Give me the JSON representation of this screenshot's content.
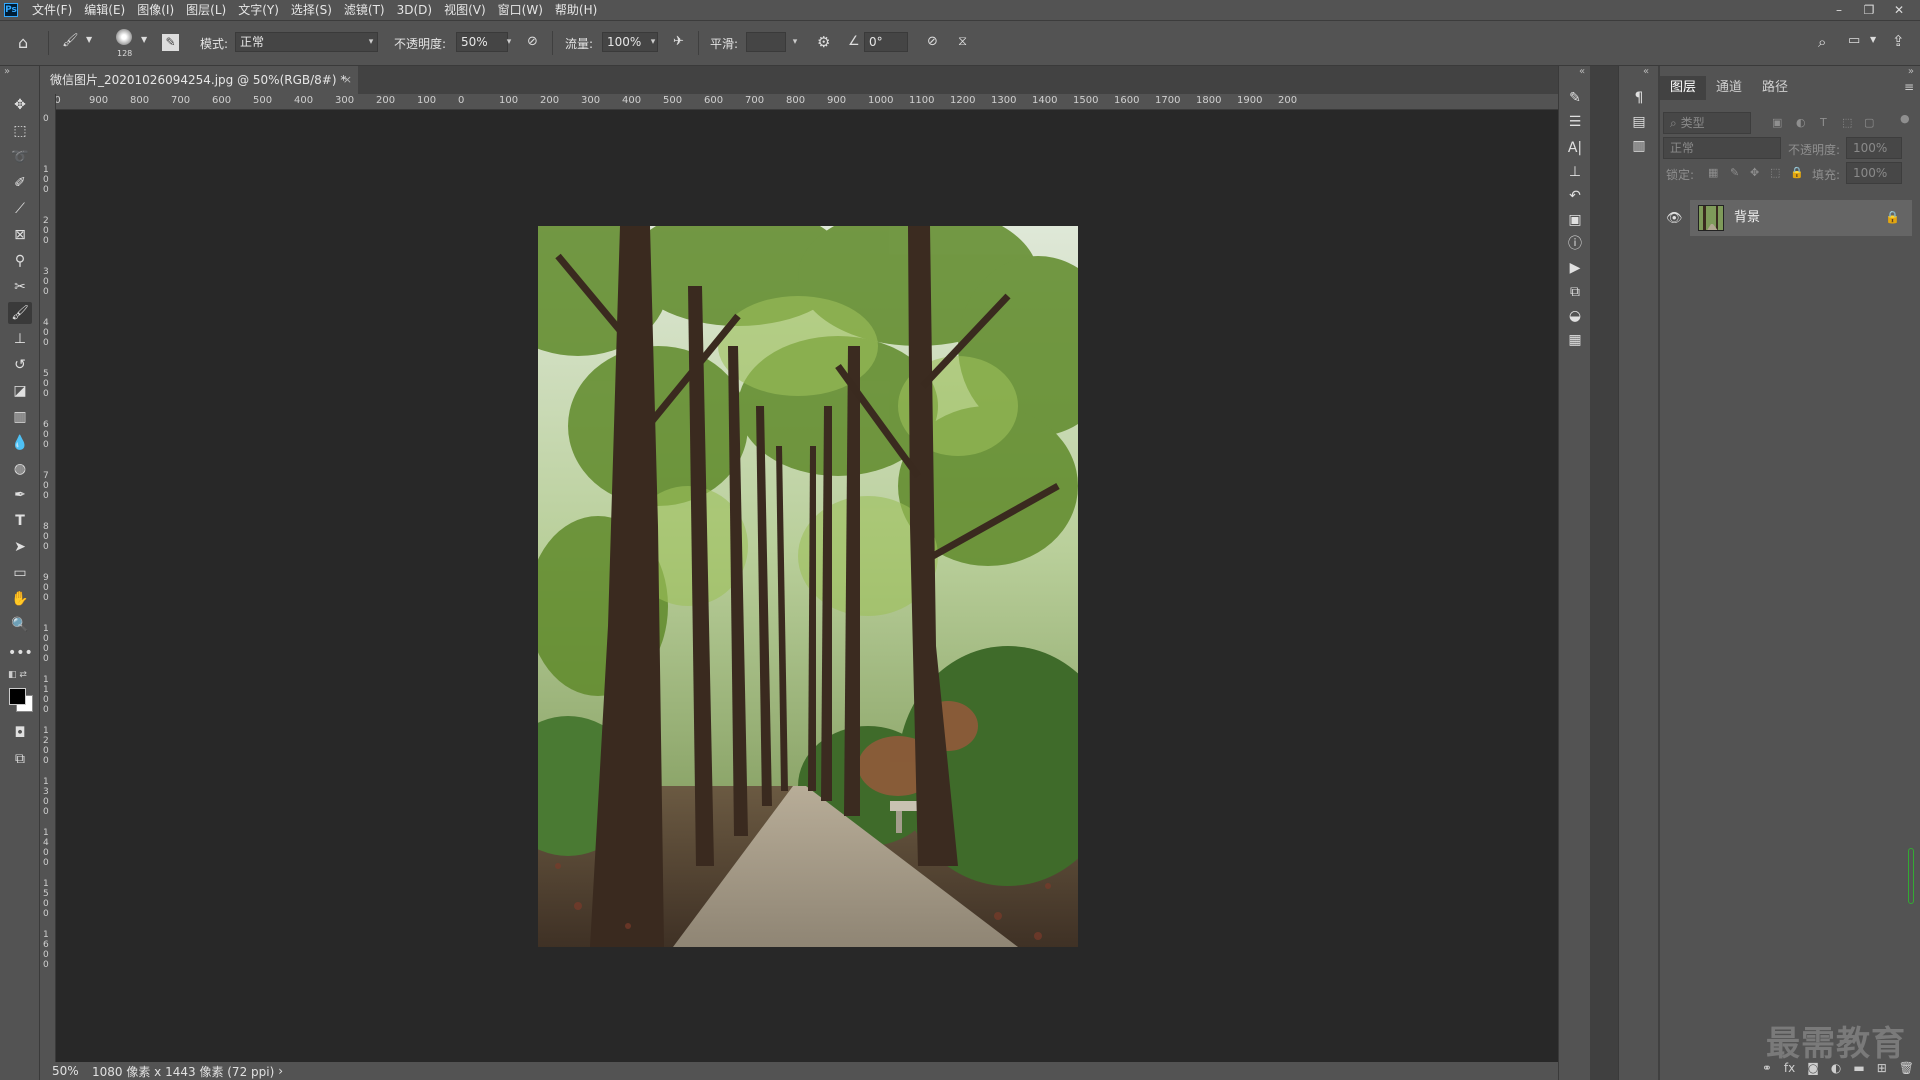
{
  "app": {
    "logo_text": "Ps"
  },
  "menu": [
    "文件(F)",
    "编辑(E)",
    "图像(I)",
    "图层(L)",
    "文字(Y)",
    "选择(S)",
    "滤镜(T)",
    "3D(D)",
    "视图(V)",
    "窗口(W)",
    "帮助(H)"
  ],
  "options": {
    "brush_size": "128",
    "mode_label": "模式:",
    "mode_value": "正常",
    "opacity_label": "不透明度:",
    "opacity_value": "50%",
    "flow_label": "流量:",
    "flow_value": "100%",
    "smoothing_label": "平滑:",
    "smoothing_value": "",
    "angle_value": "0°"
  },
  "document": {
    "tab_title": "微信图片_20201026094254.jpg @ 50%(RGB/8#) *",
    "close_glyph": "×",
    "zoom": "50%",
    "info": "1080 像素 x 1443 像素 (72 ppi)",
    "info_arrow": "›"
  },
  "ruler": {
    "top_ticks": [
      "00",
      "900",
      "800",
      "700",
      "600",
      "500",
      "400",
      "300",
      "200",
      "100",
      "0",
      "100",
      "200",
      "300",
      "400",
      "500",
      "600",
      "700",
      "800",
      "900",
      "1000",
      "1100",
      "1200",
      "1300",
      "1400",
      "1500",
      "1600",
      "1700",
      "1800",
      "1900",
      "200"
    ],
    "left_ticks": [
      "0",
      "1 0 0",
      "2 0 0",
      "3 0 0",
      "4 0 0",
      "5 0 0",
      "6 0 0",
      "7 0 0",
      "8 0 0",
      "9 0 0",
      "1 0 0 0",
      "1 1 0 0",
      "1 2 0 0",
      "1 3 0 0",
      "1 4 0 0",
      "1 5 0 0",
      "1 6 0 0"
    ]
  },
  "layers_panel": {
    "tabs": [
      "图层",
      "通道",
      "路径"
    ],
    "filter_placeholder": "类型",
    "blend_mode": "正常",
    "opacity_label": "不透明度:",
    "opacity_value": "100%",
    "lock_label": "锁定:",
    "fill_label": "填充:",
    "fill_value": "100%",
    "layer_name": "背景"
  },
  "watermark": "最需教育",
  "colors": {
    "accent": "#31a8ff",
    "panel_bg": "#535353",
    "canvas_bg": "#282828"
  }
}
